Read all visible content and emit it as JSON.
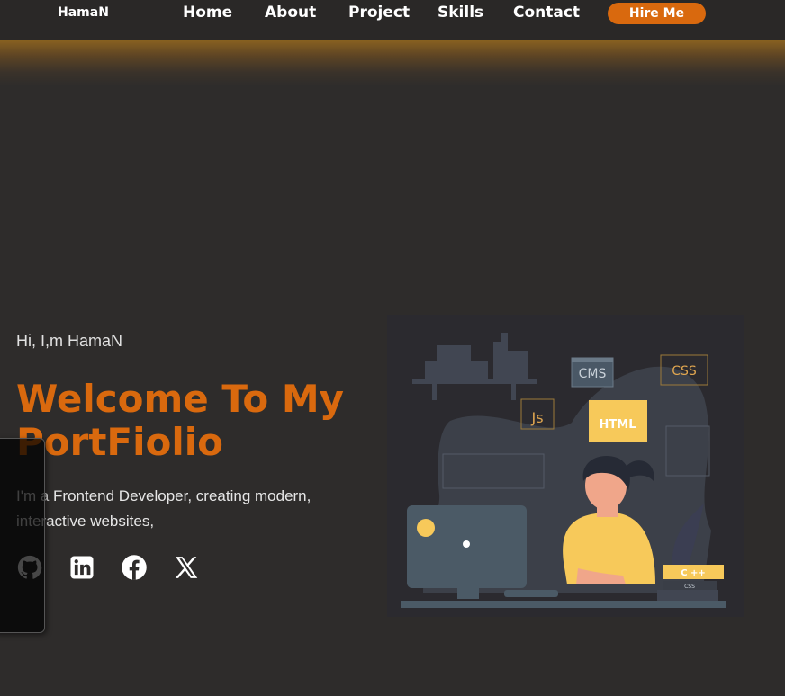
{
  "nav": {
    "logo": "HamaN",
    "links": [
      "Home",
      "About",
      "Project",
      "Skills",
      "Contact"
    ],
    "hire_label": "Hire Me"
  },
  "hero": {
    "greeting": "Hi, I,m HamaN",
    "title": "Welcome To My PortFiolio",
    "description": "I'm a Frontend Developer, creating modern, interactive websites,"
  },
  "social": [
    "github-icon",
    "linkedin-icon",
    "facebook-icon",
    "x-icon"
  ],
  "illustration": {
    "labels": [
      "CMS",
      "CSS",
      "Js",
      "HTML",
      "C ++",
      "CSS"
    ]
  },
  "colors": {
    "accent": "#d9690e",
    "background": "#2e2c2b",
    "illustration_yellow": "#f7c95a",
    "illustration_slate": "#4b5a66"
  }
}
